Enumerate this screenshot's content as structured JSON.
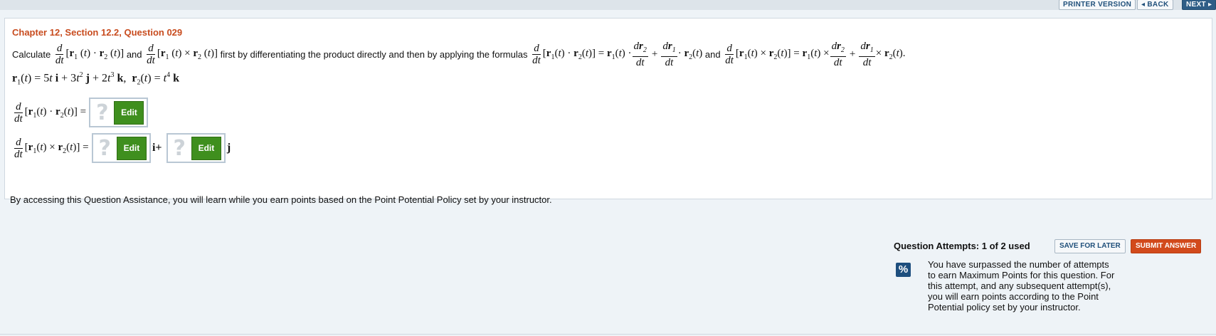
{
  "nav": {
    "printer_label": "PRINTER VERSION",
    "back_label": "◂ BACK",
    "next_label": "NEXT ▸"
  },
  "question": {
    "title": "Chapter 12, Section 12.2, Question 029",
    "calc_word": "Calculate",
    "and_word": "and",
    "middle_text": "first by differentiating the product directly and then by applying the formulas",
    "and_word2": "and"
  },
  "answers": {
    "edit_label": "Edit",
    "q_mark": "?",
    "unit_i": "i+",
    "unit_j": "j"
  },
  "info_text": "By accessing this Question Assistance, you will learn while you earn points based on the Point Potential Policy set by your instructor.",
  "footer": {
    "attempts": "Question Attempts: 1 of 2 used",
    "save_label": "SAVE FOR LATER",
    "submit_label": "SUBMIT ANSWER",
    "pct_icon": "%",
    "warning": "You have surpassed the number of attempts to earn Maximum Points for this question. For this attempt, and any subsequent attempt(s), you will earn points according to the Point Potential policy set by your instructor."
  },
  "colors": {
    "title": "#c84c1f",
    "edit_green": "#3f8f1e",
    "submit": "#d24a1c",
    "nav_next": "#2e5d86"
  }
}
